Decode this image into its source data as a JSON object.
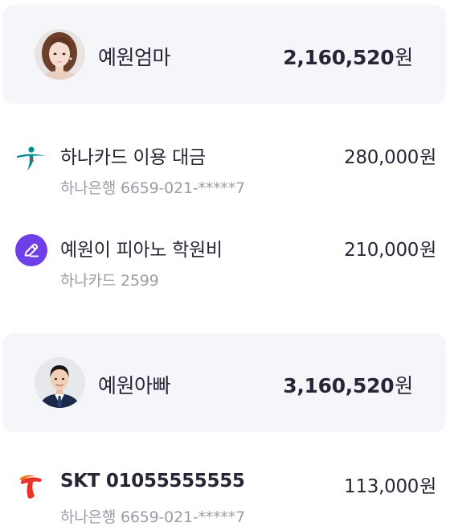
{
  "members": [
    {
      "name": "예원엄마",
      "total": "2,160,520",
      "currency": "원",
      "avatar": "woman-portrait"
    },
    {
      "name": "예원아빠",
      "total": "3,160,520",
      "currency": "원",
      "avatar": "man-portrait"
    }
  ],
  "payments": [
    {
      "icon": "hana-bank-logo",
      "icon_color": "#008c8c",
      "title": "하나카드 이용 대금",
      "subtitle": "하나은행 6659-021-*****7",
      "amount": "280,000",
      "currency": "원"
    },
    {
      "icon": "pencil-icon",
      "icon_color": "#6e3ee6",
      "title": "예원이 피아노 학원비",
      "subtitle": "하나카드 2599",
      "amount": "210,000",
      "currency": "원"
    },
    {
      "icon": "skt-logo",
      "icon_color": "#e8322a",
      "title": "SKT 01055555555",
      "subtitle": "하나은행 6659-021-*****7",
      "amount": "113,000",
      "currency": "원"
    }
  ],
  "colors": {
    "card_bg": "#f5f6fa",
    "text_primary": "#262636",
    "text_secondary": "#9b9ca6"
  }
}
